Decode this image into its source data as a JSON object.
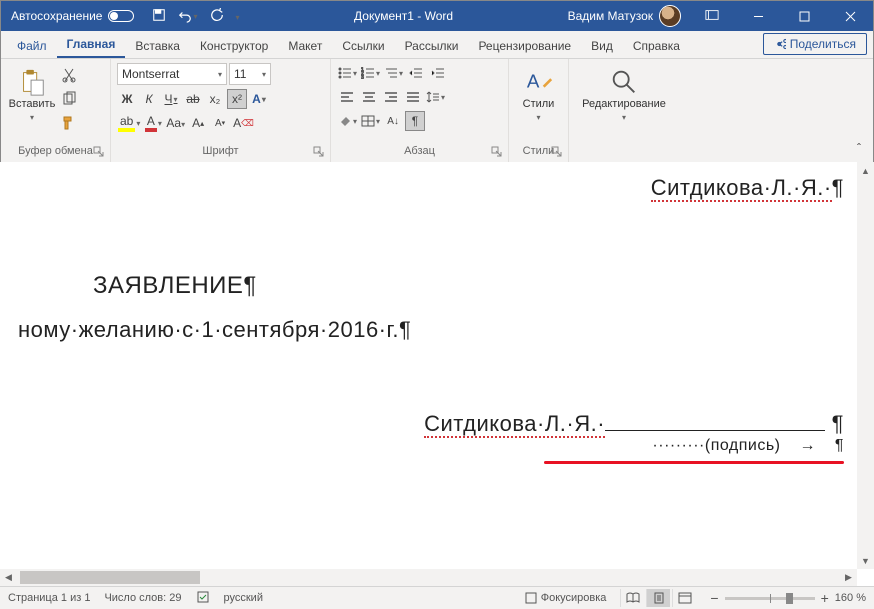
{
  "titlebar": {
    "autosave": "Автосохранение",
    "doc_title": "Документ1 - Word",
    "user_name": "Вадим Матузок"
  },
  "tabs": {
    "file": "Файл",
    "home": "Главная",
    "insert": "Вставка",
    "design": "Конструктор",
    "layout": "Макет",
    "references": "Ссылки",
    "mailings": "Рассылки",
    "review": "Рецензирование",
    "view": "Вид",
    "help": "Справка",
    "share": "Поделиться"
  },
  "ribbon": {
    "clipboard": {
      "label": "Буфер обмена",
      "paste": "Вставить"
    },
    "font": {
      "label": "Шрифт",
      "name": "Montserrat",
      "size": "11",
      "bold": "Ж",
      "italic": "К",
      "underline": "Ч",
      "strike": "ab",
      "sub": "x₂",
      "sup": "x²"
    },
    "paragraph": {
      "label": "Абзац"
    },
    "styles": {
      "label": "Стили",
      "button": "Стили"
    },
    "editing": {
      "button": "Редактирование"
    }
  },
  "document": {
    "line_header": "Ситдикова·Л.·Я.·",
    "line_title": "ЗАЯВЛЕНИЕ",
    "line_body": "ному·желанию·с·1·сентября·2016·г.",
    "line_sig_name": "Ситдикова·Л.·Я.·",
    "line_sig_caption": "·········(подпись)",
    "arrow": "→",
    "pilcrow": "¶"
  },
  "status": {
    "page": "Страница 1 из 1",
    "words": "Число слов: 29",
    "lang": "русский",
    "focus": "Фокусировка",
    "zoom": "160 %"
  }
}
